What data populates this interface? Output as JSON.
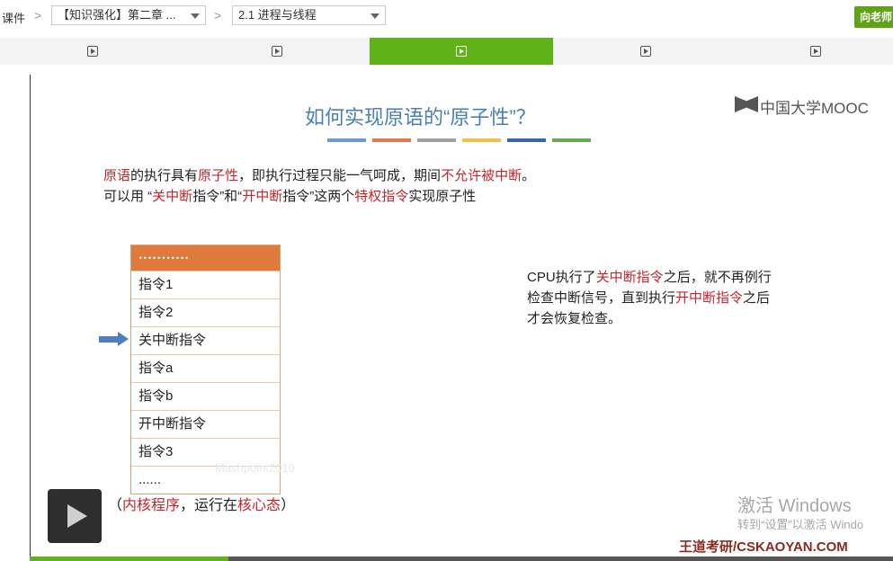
{
  "breadcrumb": {
    "root": "课件",
    "sep": ">",
    "chapter": "【知识强化】第二章 ...",
    "section": "2.1 进程与线程"
  },
  "header": {
    "teacher_button": "向老师"
  },
  "tabs": {
    "count": 5,
    "active_index": 2
  },
  "slide": {
    "title": "如何实现原语的“原子性”？",
    "brand": "中国大学MOOC",
    "bar_colors": [
      "#6b9bd1",
      "#e07a4a",
      "#a0a0a0",
      "#f2c04a",
      "#3b63b0",
      "#6aa84f"
    ],
    "line1": [
      {
        "t": "原语",
        "red": true
      },
      {
        "t": "的执行具有",
        "red": false
      },
      {
        "t": "原子性",
        "red": true
      },
      {
        "t": "，即执行过程只能一气呵成，期间",
        "red": false
      },
      {
        "t": "不允许被中断",
        "red": true
      },
      {
        "t": "。",
        "red": false
      }
    ],
    "line2": [
      {
        "t": "可以用 “",
        "red": false
      },
      {
        "t": "关中断",
        "red": true
      },
      {
        "t": "指令”和“",
        "red": false
      },
      {
        "t": "开中断",
        "red": true
      },
      {
        "t": "指令”这两个",
        "red": false
      },
      {
        "t": "特权指令",
        "red": true
      },
      {
        "t": "实现原子性",
        "red": false
      }
    ],
    "table_rows": [
      "...........",
      "指令1",
      "指令2",
      "关中断指令",
      "指令a",
      "指令b",
      "开中断指令",
      "指令3",
      "......"
    ],
    "note_lines": [
      [
        {
          "t": "CPU执行了",
          "red": false
        },
        {
          "t": "关中断指令",
          "red": true
        },
        {
          "t": "之后，就不再例行",
          "red": false
        }
      ],
      [
        {
          "t": "检查中断信号，直到执行",
          "red": false
        },
        {
          "t": "开中断指令",
          "red": true
        },
        {
          "t": "之后",
          "red": false
        }
      ],
      [
        {
          "t": "才会恢复检查。",
          "red": false
        }
      ]
    ],
    "kernel_note": [
      {
        "t": "（",
        "red": false
      },
      {
        "t": "内核程序",
        "red": true
      },
      {
        "t": "，运行在",
        "red": false
      },
      {
        "t": "核心态",
        "red": true
      },
      {
        "t": "）",
        "red": false
      }
    ],
    "faint_mark": "Mashpoint2019",
    "footer_brand": "王道考研/CSKAOYAN.COM"
  },
  "os_watermark": {
    "line1": "激活 Windows",
    "line2": "转到“设置”以激活 Windo"
  },
  "player": {
    "progress_fraction": 0.23
  }
}
